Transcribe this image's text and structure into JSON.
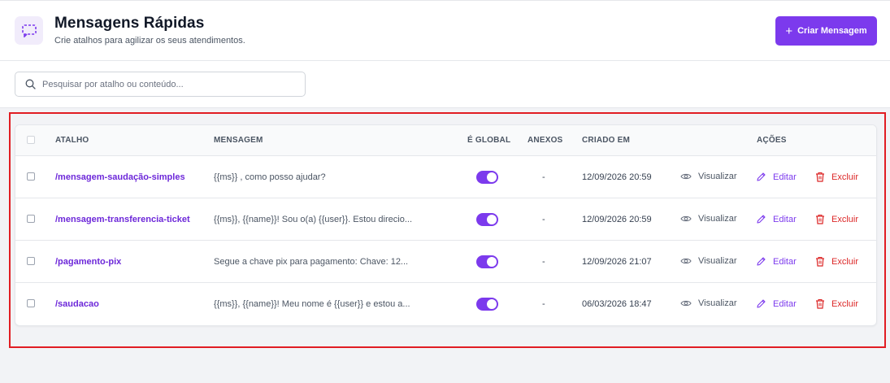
{
  "header": {
    "title": "Mensagens Rápidas",
    "subtitle": "Crie atalhos para agilizar os seus atendimentos.",
    "create_button_label": "Criar Mensagem",
    "icon": "quick-message-icon"
  },
  "search": {
    "placeholder": "Pesquisar por atalho ou conteúdo...",
    "value": ""
  },
  "table": {
    "columns": {
      "shortcut": "ATALHO",
      "message": "MENSAGEM",
      "global": "É GLOBAL",
      "attachments": "ANEXOS",
      "created": "CRIADO EM",
      "actions": "AÇÕES"
    },
    "action_labels": {
      "view": "Visualizar",
      "edit": "Editar",
      "delete": "Excluir"
    },
    "rows": [
      {
        "shortcut": "/mensagem-saudação-simples",
        "message": "{{ms}} , como posso ajudar?",
        "global": true,
        "attachments": "-",
        "created": "12/09/2026 20:59"
      },
      {
        "shortcut": "/mensagem-transferencia-ticket",
        "message": "{{ms}}, {{name}}! Sou o(a) {{user}}. Estou direcio...",
        "global": true,
        "attachments": "-",
        "created": "12/09/2026 20:59"
      },
      {
        "shortcut": "/pagamento-pix",
        "message": "Segue a chave pix para pagamento: Chave: 12...",
        "global": true,
        "attachments": "-",
        "created": "12/09/2026 21:07"
      },
      {
        "shortcut": "/saudacao",
        "message": "{{ms}}, {{name}}! Meu nome é {{user}} e estou a...",
        "global": true,
        "attachments": "-",
        "created": "06/03/2026 18:47"
      }
    ]
  },
  "colors": {
    "accent": "#7c3aed",
    "danger": "#dc2626",
    "highlight_border": "#e11d23"
  }
}
